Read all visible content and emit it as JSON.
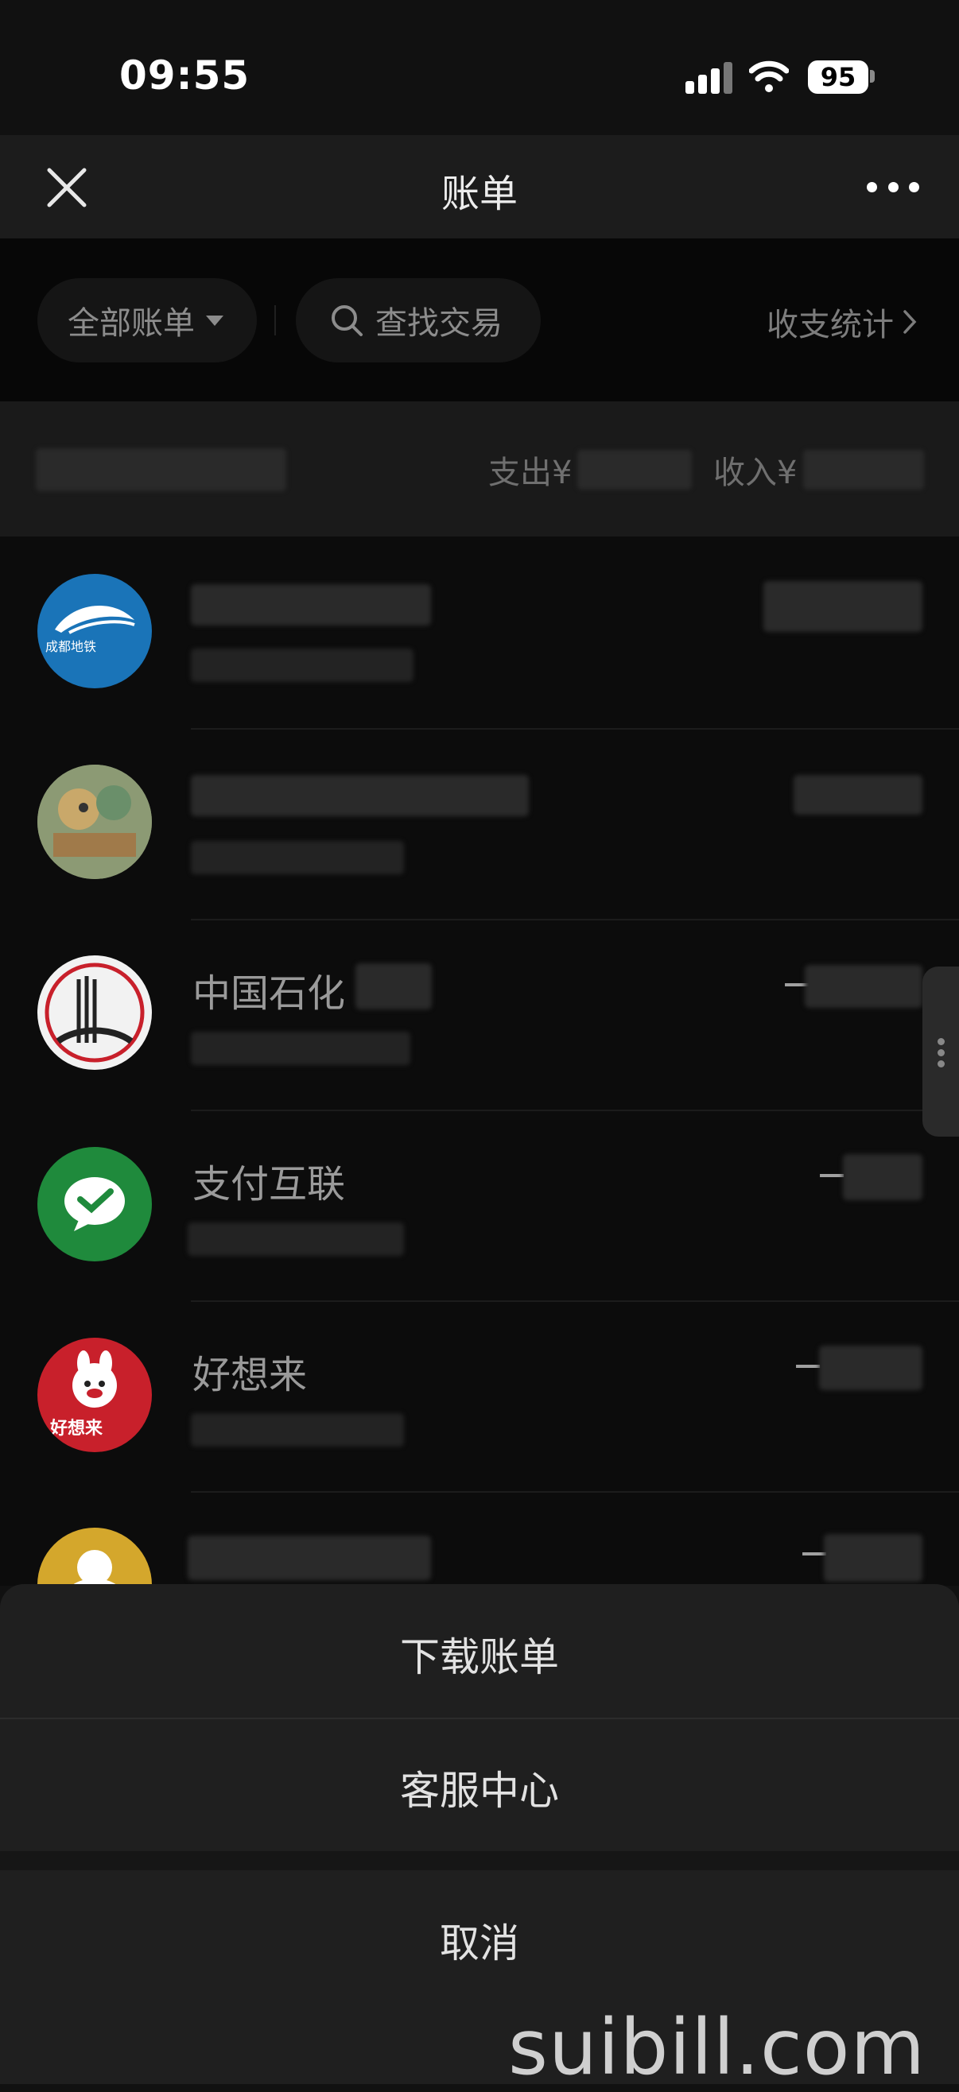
{
  "status_bar": {
    "time": "09:55",
    "battery": "95"
  },
  "header": {
    "title": "账单"
  },
  "filters": {
    "all_bills": "全部账单",
    "search_placeholder": "查找交易",
    "stats_link": "收支统计"
  },
  "summary": {
    "expense_label": "支出¥",
    "income_label": "收入¥"
  },
  "transactions": [
    {
      "merchant": "",
      "amount_prefix": "",
      "icon": "chengdu-metro-logo"
    },
    {
      "merchant": "",
      "amount_prefix": "",
      "icon": "cartoon-avatar"
    },
    {
      "merchant": "中国石化",
      "amount_prefix": "−",
      "icon": "sinopec-logo"
    },
    {
      "merchant": "支付互联",
      "amount_prefix": "−",
      "icon": "wechat-pay-logo"
    },
    {
      "merchant": "好想来",
      "amount_prefix": "−",
      "icon": "haoxianglai-logo"
    },
    {
      "merchant": "",
      "amount_prefix": "−",
      "icon": "yellow-avatar"
    }
  ],
  "logo_text": {
    "metro": "成都地铁",
    "haoxianglai": "好想来"
  },
  "action_sheet": {
    "download": "下载账单",
    "service": "客服中心",
    "cancel": "取消"
  },
  "watermark": "suibill.com",
  "colors": {
    "background": "#111111",
    "sheet": "#1f1f1f",
    "wechat_green": "#1f8a3c",
    "metro_blue": "#1a74b8",
    "haoxianglai_red": "#c8202b"
  }
}
